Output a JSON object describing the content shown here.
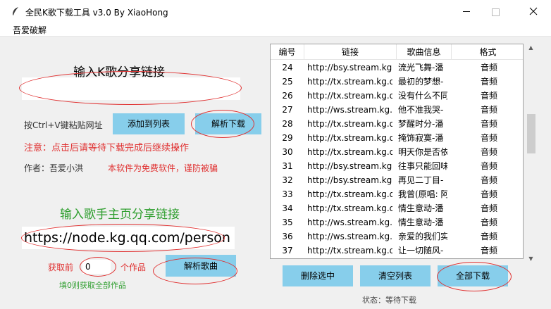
{
  "window": {
    "title": "全民K歌下载工具 v3.0 By XiaoHong"
  },
  "menu": {
    "item": "吾爱破解"
  },
  "left": {
    "share_title": "输入K歌分享链接",
    "share_input_value": "",
    "paste_hint": "按Ctrl+V键粘贴网址",
    "add_button": "添加到列表",
    "parse_button": "解析下载",
    "notice": "注意：点击后请等待下载完成后继续操作",
    "author": "作者：吾爱小洪",
    "free_notice": "本软件为免费软件，谨防被骗",
    "singer_title": "输入歌手主页分享链接",
    "singer_input_value": "https://node.kg.qq.com/person",
    "fetch_prefix": "获取前",
    "fetch_count": "0",
    "fetch_suffix": "个作品",
    "parse_songs_button": "解析歌曲",
    "fetch_hint": "填0则获取全部作品"
  },
  "list": {
    "columns": [
      "编号",
      "链接",
      "歌曲信息",
      "格式"
    ],
    "rows": [
      [
        "24",
        "http://bsy.stream.kg.qq.com",
        "流光飞舞-潘",
        "音频"
      ],
      [
        "25",
        "http://tx.stream.kg.qq.com",
        "最初的梦想-",
        "音频"
      ],
      [
        "26",
        "http://tx.stream.kg.qq.com",
        "没有什么不同",
        "音频"
      ],
      [
        "27",
        "http://ws.stream.kg.qq.com",
        "他不准我哭-",
        "音频"
      ],
      [
        "28",
        "http://tx.stream.kg.qq.com",
        "梦醒时分-潘",
        "音频"
      ],
      [
        "29",
        "http://tx.stream.kg.qq.com",
        "掩饰寂寞-潘",
        "音频"
      ],
      [
        "30",
        "http://tx.stream.kg.qq.com",
        "明天你是否依",
        "音频"
      ],
      [
        "31",
        "http://bsy.stream.kg.qq.com",
        "往事只能回味",
        "音频"
      ],
      [
        "32",
        "http://bsy.stream.kg.qq.com",
        "再见二丁目-",
        "音频"
      ],
      [
        "33",
        "http://tx.stream.kg.qq.com",
        "我曾(原唱: 阿",
        "音频"
      ],
      [
        "34",
        "http://tx.stream.kg.qq.com",
        "情生意动-潘",
        "音频"
      ],
      [
        "35",
        "http://ws.stream.kg.qq.com",
        "情生意动-潘",
        "音频"
      ],
      [
        "36",
        "http://ws.stream.kg.qq.com",
        "亲爱的我们实",
        "音频"
      ],
      [
        "37",
        "http://tx.stream.kg.qq.com",
        "让一切随风-",
        "音频"
      ]
    ]
  },
  "bottom": {
    "delete_button": "删除选中",
    "clear_button": "清空列表",
    "download_all_button": "全部下载",
    "status": "状态：等待下载"
  },
  "colors": {
    "button_bg": "#87ceeb",
    "red_text": "#e03030",
    "green_text": "#2e9e2e"
  }
}
